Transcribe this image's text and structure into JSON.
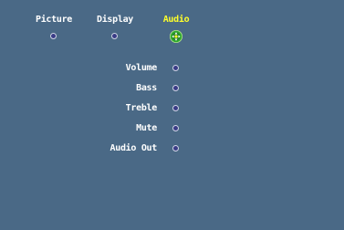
{
  "tabs": [
    {
      "label": "Picture",
      "active": false
    },
    {
      "label": "Display",
      "active": false
    },
    {
      "label": "Audio",
      "active": true
    }
  ],
  "menu": {
    "items": [
      {
        "label": "Volume"
      },
      {
        "label": "Bass"
      },
      {
        "label": "Treble"
      },
      {
        "label": "Mute"
      },
      {
        "label": "Audio Out"
      }
    ]
  },
  "colors": {
    "background": "#4a6986",
    "active_tab": "#ffff2a",
    "text": "#ffffff",
    "selector": "#2fa82f"
  },
  "icons": {
    "selector": "green-directional-selector-icon",
    "option": "radio-dot-icon"
  }
}
